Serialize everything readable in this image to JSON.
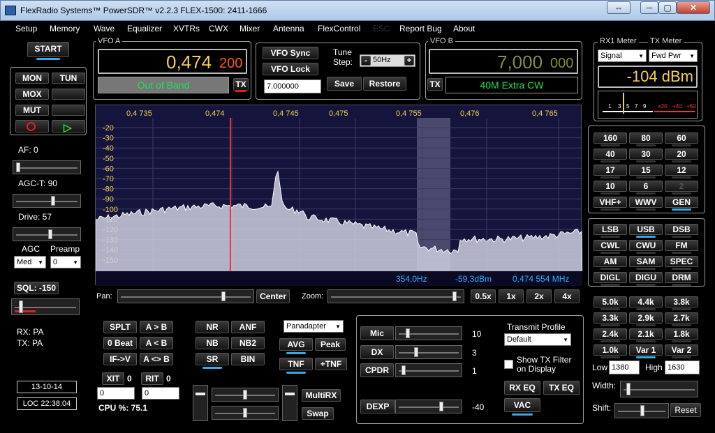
{
  "window": {
    "title": "FlexRadio Systems™  PowerSDR™  v2.2.3   FLEX-1500: 2411-1666",
    "restore_label": "⇔",
    "min_label": "─",
    "max_label": "▢",
    "close_label": "✕"
  },
  "menu": [
    "Setup",
    "Memory",
    "Wave",
    "Equalizer",
    "XVTRs",
    "CWX",
    "Mixer",
    "Antenna",
    "FlexControl",
    "ESC",
    "Report Bug",
    "About"
  ],
  "start_label": "START",
  "left": {
    "mon": "MON",
    "tun": "TUN",
    "mox": "MOX",
    "mut": "MUT",
    "rec_icon": "record-icon",
    "play_icon": "play-icon",
    "af_label": "AF:  0",
    "agct_label": "AGC-T:  90",
    "drive_label": "Drive:  57",
    "agc_label": "AGC",
    "preamp_label": "Preamp",
    "agc_value": "Med",
    "preamp_value": "0",
    "sql_label": "SQL: -150",
    "rx_pa": "RX: PA",
    "tx_pa": "TX: PA",
    "date": "13-10-14",
    "loc_time": "LOC 22:38:04"
  },
  "levels": {
    "af": 0.0,
    "agct": 0.62,
    "drive": 0.57,
    "sql": 0.08
  },
  "vfoa": {
    "label": "VFO A",
    "freq_main": "0,474",
    "freq_sub": "200",
    "status": "Out of Band",
    "tx": "TX"
  },
  "vfoctrl": {
    "sync": "VFO Sync",
    "lock": "VFO Lock",
    "tune_step_label": "Tune\nStep:",
    "minus": "-",
    "plus": "+",
    "step": "50Hz",
    "freq_field": "7.000000",
    "save": "Save",
    "restore": "Restore"
  },
  "vfob": {
    "label": "VFO B",
    "freq_main": "7,000",
    "freq_sub": "000",
    "tx": "TX",
    "band": "40M Extra CW"
  },
  "meter": {
    "rx_label": "RX1 Meter",
    "tx_label": "TX Meter",
    "rx_sel": "Signal",
    "tx_sel": "Fwd Pwr",
    "reading": "-104 dBm",
    "scale_white": [
      "1",
      "3",
      "5",
      "7",
      "9"
    ],
    "scale_red": [
      "+20",
      "+40",
      "+60"
    ]
  },
  "spectrum": {
    "freq_ticks": [
      "0,4 735",
      "0,474",
      "0,4 745",
      "0,475",
      "0,4 755",
      "0,476",
      "0,4 765"
    ],
    "db_ticks": [
      "-20",
      "-30",
      "-40",
      "-50",
      "-60",
      "-70",
      "-80",
      "-90",
      "-100",
      "-110",
      "-120",
      "-130",
      "-140",
      "-150"
    ],
    "cursor_hz": "354,0Hz",
    "cursor_dbm": "-59,3dBm",
    "cursor_mhz": "0,474 554 MHz"
  },
  "panzoom": {
    "pan_label": "Pan:",
    "center": "Center",
    "zoom_label": "Zoom:",
    "z05": "0.5x",
    "z1": "1x",
    "z2": "2x",
    "z4": "4x"
  },
  "bands": [
    "160",
    "80",
    "60",
    "40",
    "30",
    "20",
    "17",
    "15",
    "12",
    "10",
    "6",
    "2",
    "VHF+",
    "WWV",
    "GEN"
  ],
  "modes": [
    "LSB",
    "USB",
    "DSB",
    "CWL",
    "CWU",
    "FM",
    "AM",
    "SAM",
    "SPEC",
    "DIGL",
    "DIGU",
    "DRM"
  ],
  "filters": [
    "5.0k",
    "4.4k",
    "3.8k",
    "3.3k",
    "2.9k",
    "2.7k",
    "2.4k",
    "2.1k",
    "1.8k",
    "1.0k",
    "Var 1",
    "Var 2"
  ],
  "filter_params": {
    "low_label": "Low",
    "low": "1380",
    "high_label": "High",
    "high": "1630",
    "width_label": "Width:",
    "shift_label": "Shift:",
    "reset": "Reset"
  },
  "dsp": {
    "splt": "SPLT",
    "atob": "A > B",
    "zerobeat": "0 Beat",
    "alessb": "A < B",
    "ifv": "IF->V",
    "aswap": "A <> B",
    "xit": "XIT",
    "xit_val": "0",
    "rit": "RIT",
    "rit_val": "0",
    "xit_field": "0",
    "rit_field": "0",
    "cpu": "CPU %:  75.1",
    "nr": "NR",
    "anf": "ANF",
    "nb": "NB",
    "nb2": "NB2",
    "sr": "SR",
    "bin": "BIN",
    "display_mode": "Panadapter",
    "avg": "AVG",
    "peak": "Peak",
    "tnf": "TNF",
    "ptnf": "+TNF",
    "multirx": "MultiRX",
    "swap": "Swap"
  },
  "tx": {
    "mic": "Mic",
    "mic_val": "10",
    "dx": "DX",
    "dx_val": "3",
    "cpdr": "CPDR",
    "cpdr_val": "1",
    "dexp": "DEXP",
    "dexp_val": "-40",
    "profile_label": "Transmit Profile",
    "profile": "Default",
    "show_filter": "Show TX Filter\non Display",
    "rxeq": "RX EQ",
    "txeq": "TX EQ",
    "vac": "VAC"
  },
  "colors": {
    "vfo_freq": "#f5d24a",
    "vfo_sub": "#ff5a1e",
    "vfob_freq": "#8a8a3a",
    "green_text": "#1ee05a",
    "blue_readout": "#2ab0ff",
    "red_line": "#ff2a2a",
    "spectrum_bg": "#14143c"
  }
}
